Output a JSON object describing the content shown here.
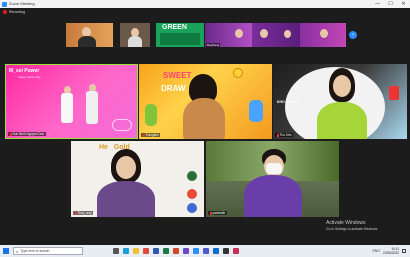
{
  "window": {
    "title": "Zoom Meeting",
    "minimize": "—",
    "maximize": "☐",
    "close": "✕"
  },
  "recording": {
    "label": "Recording"
  },
  "filmstrip": {
    "arrow_icon": "chevron-right-icon",
    "overlay_texts": [
      "GREEN"
    ],
    "names": [
      "",
      "",
      "",
      "Meyfhsng",
      "",
      "",
      ""
    ]
  },
  "tiles": {
    "t1": {
      "name": "Sun Ninh Nguyen Duc",
      "banner": "M_sei Power",
      "subtitle": "Happy Dance Day"
    },
    "t2": {
      "name": "Trangtien",
      "banner_top": "SWEET",
      "banner_bottom": "DRAW"
    },
    "t3": {
      "name": "Thu Kim",
      "brand": "KHO CHUNG"
    },
    "t4": {
      "name": "Thuy_ang",
      "banner": "He   Gold"
    },
    "t5": {
      "name": "yanmaile"
    }
  },
  "raise_hand_icon": "raise-hand-icon",
  "watermark": {
    "title": "Activate Windows",
    "subtitle": "Go to Settings to activate Windows."
  },
  "taskbar": {
    "search_placeholder": "Type here to search",
    "tray_language": "ENG",
    "time": "10:11",
    "date": "22/06/2022"
  }
}
